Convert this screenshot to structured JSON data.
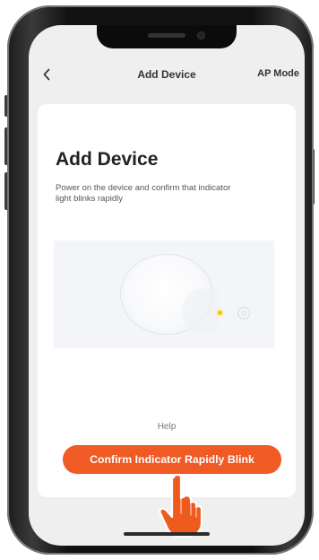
{
  "nav": {
    "title": "Add Device",
    "mode": "AP Mode",
    "back_icon": "chevron-left-icon"
  },
  "content": {
    "title": "Add Device",
    "description": "Power on the device and confirm that indicator light blinks rapidly",
    "help": "Help",
    "confirm_button": "Confirm Indicator Rapidly Blink"
  },
  "illustration": {
    "device_icon": "smart-device-icon",
    "indicator_color": "#f5c400"
  },
  "gesture": {
    "icon": "pointing-hand-icon"
  },
  "colors": {
    "accent": "#f05a24",
    "screen_background": "#efefef",
    "card_background": "#ffffff"
  }
}
